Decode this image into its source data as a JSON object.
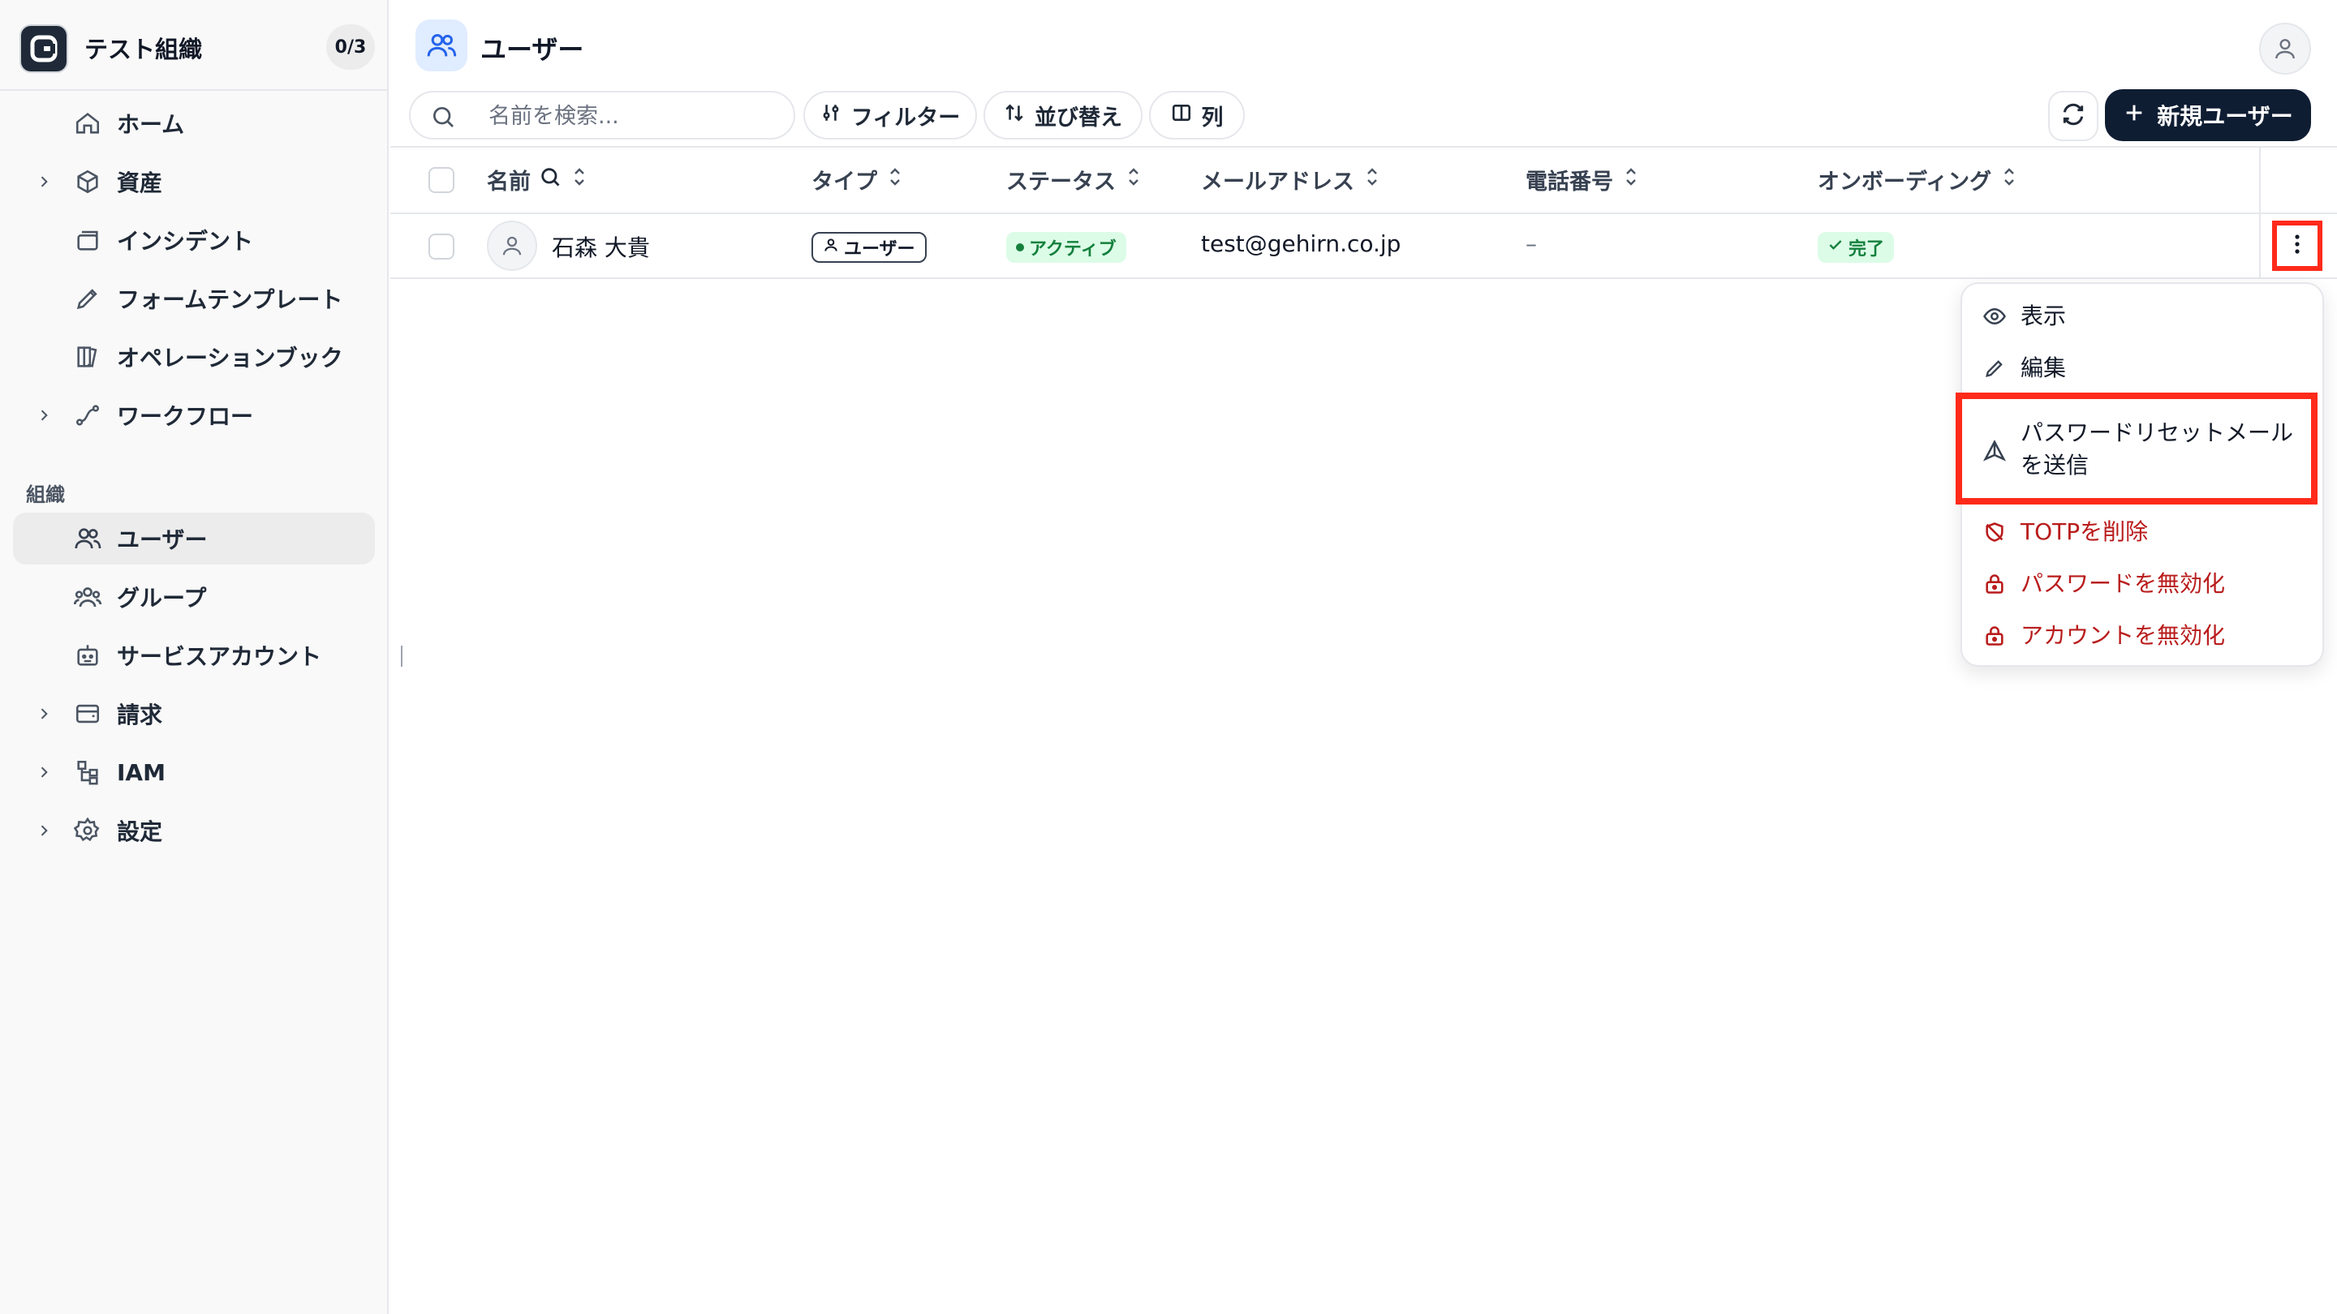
{
  "org": {
    "name": "テスト組織",
    "count": "0/3"
  },
  "sidebar": {
    "items": [
      {
        "label": "ホーム"
      },
      {
        "label": "資産"
      },
      {
        "label": "インシデント"
      },
      {
        "label": "フォームテンプレート"
      },
      {
        "label": "オペレーションブック"
      },
      {
        "label": "ワークフロー"
      }
    ],
    "section_label": "組織",
    "org_items": [
      {
        "label": "ユーザー"
      },
      {
        "label": "グループ"
      },
      {
        "label": "サービスアカウント"
      },
      {
        "label": "請求"
      },
      {
        "label": "IAM"
      },
      {
        "label": "設定"
      }
    ]
  },
  "header": {
    "title": "ユーザー"
  },
  "toolbar": {
    "search_placeholder": "名前を検索...",
    "filter_label": "フィルター",
    "sort_label": "並び替え",
    "columns_label": "列",
    "new_user_label": "新規ユーザー"
  },
  "table": {
    "columns": [
      "名前",
      "タイプ",
      "ステータス",
      "メールアドレス",
      "電話番号",
      "オンボーディング"
    ],
    "rows": [
      {
        "name": "石森 大貴",
        "type": "ユーザー",
        "status": "アクティブ",
        "email": "test@gehirn.co.jp",
        "phone": "–",
        "onboarding": "完了"
      }
    ]
  },
  "menu": {
    "items": [
      {
        "label": "表示",
        "icon": "eye-icon"
      },
      {
        "label": "編集",
        "icon": "pencil-icon"
      },
      {
        "label": "パスワードリセットメールを送信",
        "icon": "send-icon"
      },
      {
        "label": "TOTPを削除",
        "icon": "shield-off-icon"
      },
      {
        "label": "パスワードを無効化",
        "icon": "lock-icon"
      },
      {
        "label": "アカウントを無効化",
        "icon": "lock-icon"
      }
    ]
  },
  "colors": {
    "accent": "#0f1d33",
    "danger": "#b91c1c",
    "success": "#15803d",
    "highlight": "#ff2a1a"
  }
}
